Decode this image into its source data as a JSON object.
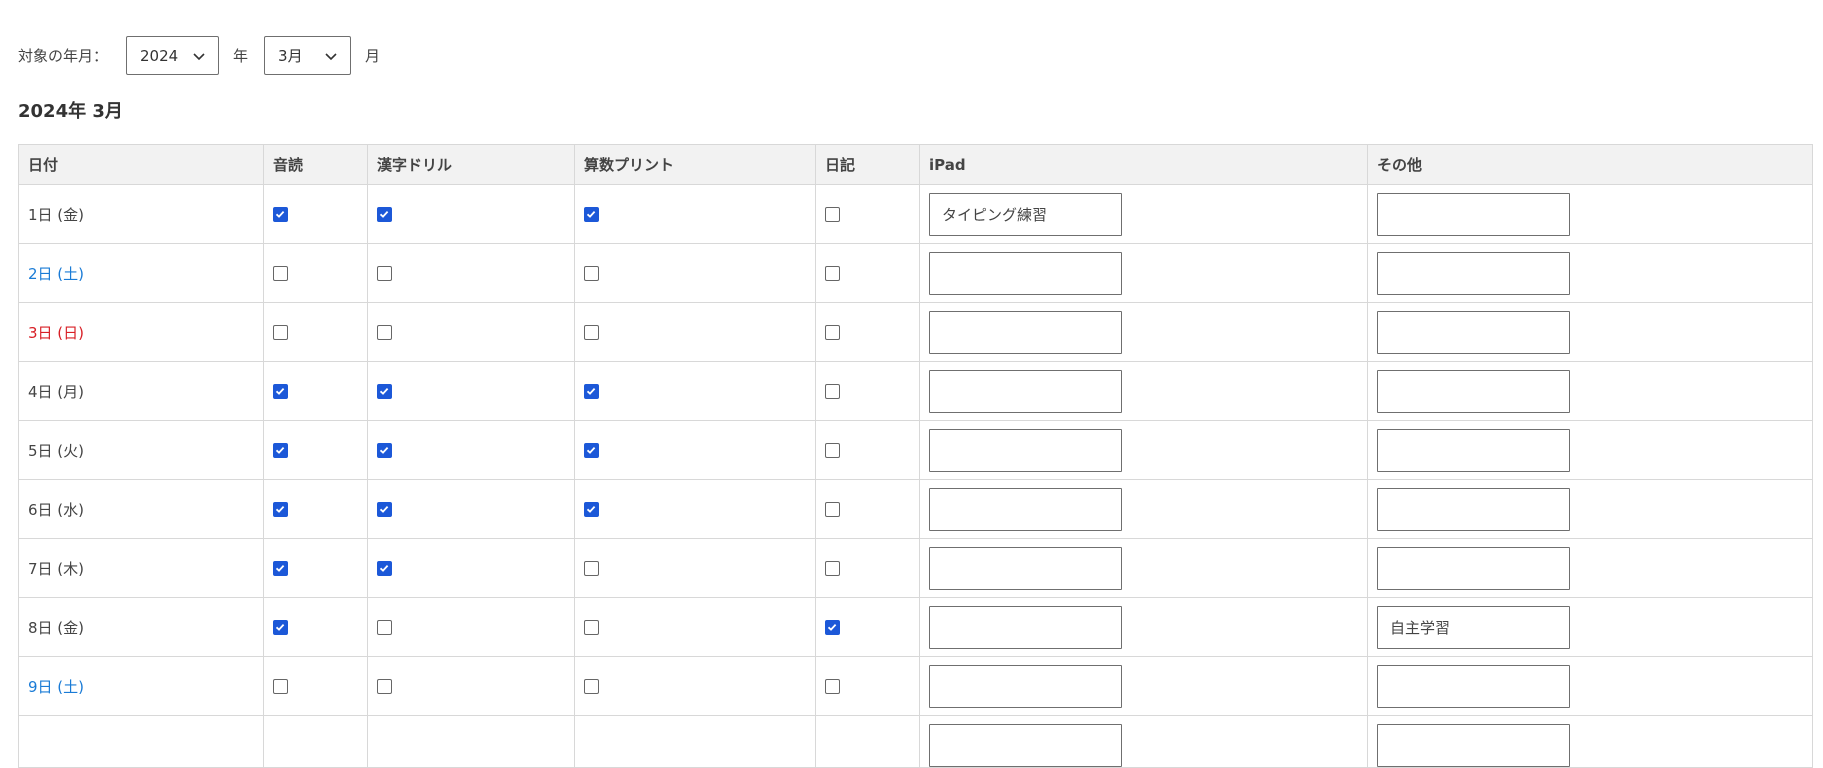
{
  "filter": {
    "label": "対象の年月：",
    "year": "2024",
    "year_unit": "年",
    "month": "3月",
    "month_unit": "月"
  },
  "heading": "2024年 3月",
  "table": {
    "headers": [
      "日付",
      "音読",
      "漢字ドリル",
      "算数プリント",
      "日記",
      "iPad",
      "その他"
    ],
    "rows": [
      {
        "date": "1日 (金)",
        "day_type": "weekday",
        "ondoku": true,
        "kanji": true,
        "sansu": true,
        "nikki": false,
        "ipad": "タイピング練習",
        "other": ""
      },
      {
        "date": "2日 (土)",
        "day_type": "saturday",
        "ondoku": false,
        "kanji": false,
        "sansu": false,
        "nikki": false,
        "ipad": "",
        "other": ""
      },
      {
        "date": "3日 (日)",
        "day_type": "sunday",
        "ondoku": false,
        "kanji": false,
        "sansu": false,
        "nikki": false,
        "ipad": "",
        "other": ""
      },
      {
        "date": "4日 (月)",
        "day_type": "weekday",
        "ondoku": true,
        "kanji": true,
        "sansu": true,
        "nikki": false,
        "ipad": "",
        "other": ""
      },
      {
        "date": "5日 (火)",
        "day_type": "weekday",
        "ondoku": true,
        "kanji": true,
        "sansu": true,
        "nikki": false,
        "ipad": "",
        "other": ""
      },
      {
        "date": "6日 (水)",
        "day_type": "weekday",
        "ondoku": true,
        "kanji": true,
        "sansu": true,
        "nikki": false,
        "ipad": "",
        "other": ""
      },
      {
        "date": "7日 (木)",
        "day_type": "weekday",
        "ondoku": true,
        "kanji": true,
        "sansu": false,
        "nikki": false,
        "ipad": "",
        "other": ""
      },
      {
        "date": "8日 (金)",
        "day_type": "weekday",
        "ondoku": true,
        "kanji": false,
        "sansu": false,
        "nikki": true,
        "ipad": "",
        "other": "自主学習"
      },
      {
        "date": "9日 (土)",
        "day_type": "saturday",
        "ondoku": false,
        "kanji": false,
        "sansu": false,
        "nikki": false,
        "ipad": "",
        "other": ""
      }
    ]
  },
  "colors": {
    "checkbox_checked": "#1c58d8",
    "saturday": "#1a7bd6",
    "sunday": "#d81f26",
    "header_bg": "#f2f2f2"
  },
  "icons": {
    "select_arrow": "chevron-down-icon",
    "check": "checkmark-icon"
  }
}
